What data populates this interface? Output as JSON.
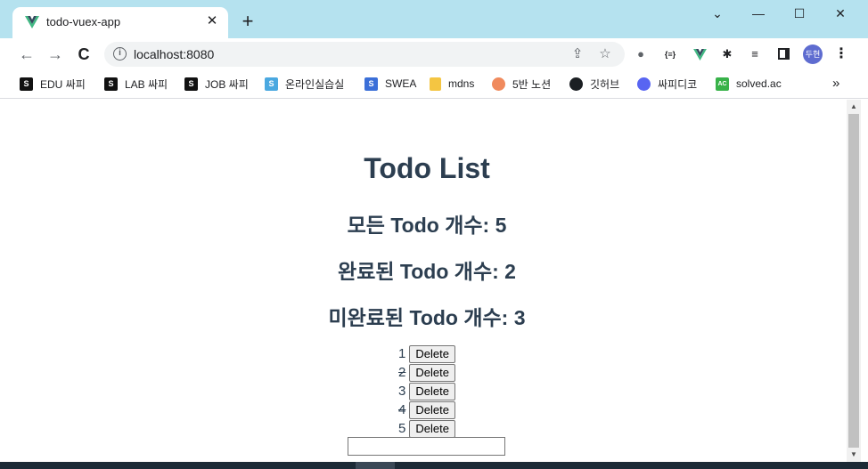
{
  "tab": {
    "title": "todo-vuex-app",
    "close": "✕",
    "new_tab": "+"
  },
  "window_controls": {
    "minimize": "—",
    "maximize": "☐",
    "close": "✕",
    "dropdown": "⌄"
  },
  "nav": {
    "back": "←",
    "forward": "→",
    "reload": "C"
  },
  "address": {
    "url": "localhost:8080"
  },
  "profile": {
    "label": "두현"
  },
  "bookmarks": [
    {
      "label": "EDU 싸피",
      "icon": "ssafy-icon",
      "color": "#111111",
      "glyph": "S"
    },
    {
      "label": "LAB 싸피",
      "icon": "ssafy-icon",
      "color": "#111111",
      "glyph": "S"
    },
    {
      "label": "JOB 싸피",
      "icon": "ssafy-icon",
      "color": "#111111",
      "glyph": "S"
    },
    {
      "label": "온라인실습실",
      "icon": "ssafy-blue-icon",
      "color": "#4aa8e0",
      "glyph": "S"
    },
    {
      "label": "SWEA",
      "icon": "swea-icon",
      "color": "#3b6fd8",
      "glyph": "S"
    },
    {
      "label": "mdns",
      "icon": "folder-icon",
      "color": "#f4c542",
      "glyph": ""
    },
    {
      "label": "5반 노션",
      "icon": "peach-icon",
      "color": "#f08a5d",
      "glyph": ""
    },
    {
      "label": "깃허브",
      "icon": "github-icon",
      "color": "#1b1f23",
      "glyph": ""
    },
    {
      "label": "싸피디코",
      "icon": "discord-icon",
      "color": "#5865f2",
      "glyph": ""
    },
    {
      "label": "solved.ac",
      "icon": "solvedac-icon",
      "color": "#38b249",
      "glyph": "AC"
    }
  ],
  "bookmarks_more": "»",
  "page": {
    "title": "Todo List",
    "total": "모든 Todo 개수: 5",
    "completed": "완료된 Todo 개수: 2",
    "uncompleted": "미완료된 Todo 개수: 3",
    "delete_label": "Delete",
    "input_value": "",
    "todos": [
      {
        "title": "1",
        "completed": false
      },
      {
        "title": "2",
        "completed": true
      },
      {
        "title": "3",
        "completed": false
      },
      {
        "title": "4",
        "completed": true
      },
      {
        "title": "5",
        "completed": false
      }
    ]
  }
}
